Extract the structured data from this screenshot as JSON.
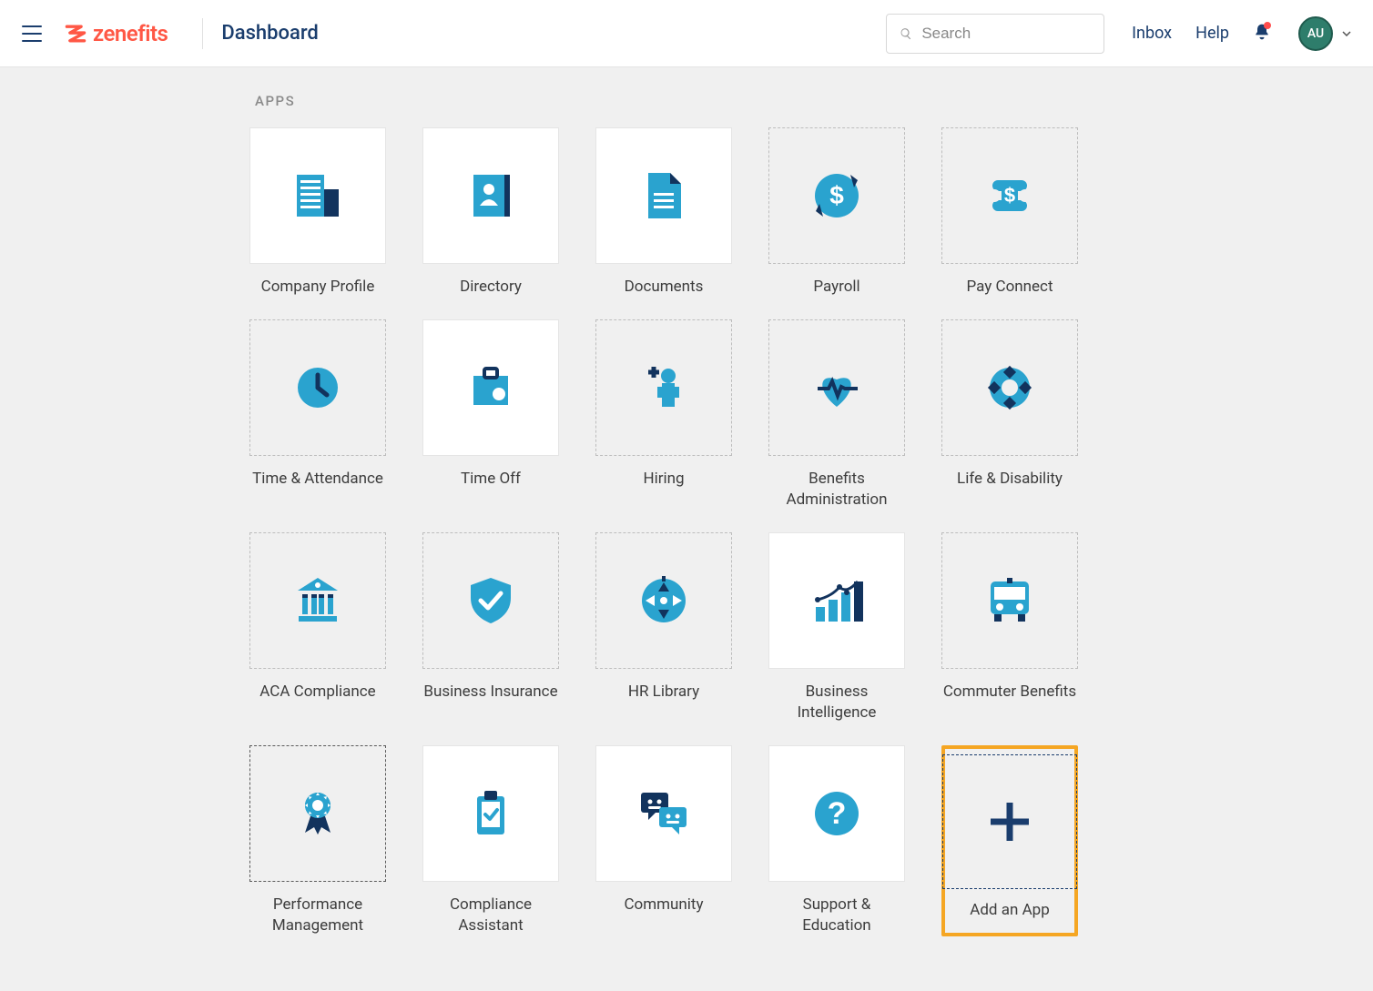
{
  "brand": {
    "name": "zenefits"
  },
  "page_title": "Dashboard",
  "search": {
    "placeholder": "Search"
  },
  "nav": {
    "inbox": "Inbox",
    "help": "Help"
  },
  "user": {
    "initials": "AU"
  },
  "section_label": "APPS",
  "apps": [
    {
      "label": "Company Profile",
      "style": "solid",
      "icon": "company-profile-icon"
    },
    {
      "label": "Directory",
      "style": "solid",
      "icon": "directory-icon"
    },
    {
      "label": "Documents",
      "style": "solid",
      "icon": "documents-icon"
    },
    {
      "label": "Payroll",
      "style": "dashed",
      "icon": "payroll-icon"
    },
    {
      "label": "Pay Connect",
      "style": "dashed",
      "icon": "pay-connect-icon"
    },
    {
      "label": "Time & Attendance",
      "style": "dashed",
      "icon": "time-attendance-icon"
    },
    {
      "label": "Time Off",
      "style": "solid",
      "icon": "time-off-icon"
    },
    {
      "label": "Hiring",
      "style": "dashed",
      "icon": "hiring-icon"
    },
    {
      "label": "Benefits Administration",
      "style": "dashed",
      "icon": "benefits-admin-icon"
    },
    {
      "label": "Life & Disability",
      "style": "dashed",
      "icon": "life-disability-icon"
    },
    {
      "label": "ACA Compliance",
      "style": "dashed",
      "icon": "aca-compliance-icon"
    },
    {
      "label": "Business Insurance",
      "style": "dashed",
      "icon": "business-insurance-icon"
    },
    {
      "label": "HR Library",
      "style": "dashed",
      "icon": "hr-library-icon"
    },
    {
      "label": "Business Intelligence",
      "style": "solid",
      "icon": "business-intelligence-icon"
    },
    {
      "label": "Commuter Benefits",
      "style": "dashed",
      "icon": "commuter-benefits-icon"
    },
    {
      "label": "Performance Management",
      "style": "dashed-dark",
      "icon": "performance-mgmt-icon"
    },
    {
      "label": "Compliance Assistant",
      "style": "solid",
      "icon": "compliance-assistant-icon"
    },
    {
      "label": "Community",
      "style": "solid",
      "icon": "community-icon"
    },
    {
      "label": "Support & Education",
      "style": "solid",
      "icon": "support-education-icon"
    },
    {
      "label": "Add an App",
      "style": "add",
      "icon": "add-app-icon",
      "highlighted": true
    }
  ],
  "colors": {
    "brand_orange": "#ff5745",
    "primary_blue": "#1a3d6d",
    "accent_cyan": "#2aa3cf",
    "dark_navy": "#12335d",
    "highlight_orange": "#f5a623"
  }
}
